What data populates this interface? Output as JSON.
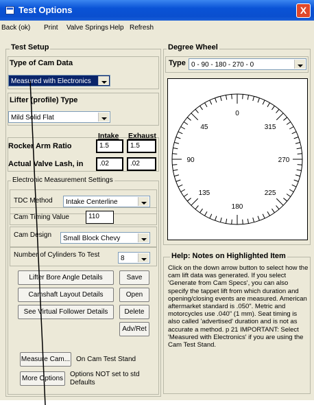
{
  "window": {
    "title": "Test Options",
    "close": "X"
  },
  "menu": [
    "Back (ok)",
    "Print",
    "Valve Springs",
    "Help",
    "Refresh"
  ],
  "test_setup": {
    "title": "Test Setup",
    "cam_data_label": "Type of Cam Data",
    "cam_data_value": "Measured with Electronics",
    "lifter_label": "Lifter (profile) Type",
    "lifter_value": "Mild Solid Flat",
    "intake_header": "Intake",
    "exhaust_header": "Exhaust",
    "rocker_label": "Rocker Arm Ratio",
    "rocker_intake": "1.5",
    "rocker_exhaust": "1.5",
    "lash_label": "Actual Valve Lash, in",
    "lash_intake": ".02",
    "lash_exhaust": ".02"
  },
  "electronic": {
    "title": "Electronic Measurement Settings",
    "tdc_label": "TDC Method",
    "tdc_value": "Intake Centerline",
    "timing_label": "Cam Timing Value",
    "timing_value": "110",
    "design_label": "Cam Design",
    "design_value": "Small Block Chevy",
    "cylinders_label": "Number of Cylinders To Test",
    "cylinders_value": "8",
    "btn_lifter": "Lifter Bore Angle Details",
    "btn_camshaft": "Camshaft Layout Details",
    "btn_follower": "See Virtual Follower Details",
    "btn_save": "Save",
    "btn_open": "Open",
    "btn_delete": "Delete",
    "btn_advret": "Adv/Ret",
    "btn_measure": "Measure Cam...",
    "measure_status": "On Cam Test Stand",
    "btn_more": "More Options",
    "more_status_1": "Options NOT set to std",
    "more_status_2": "Defaults"
  },
  "degree_wheel": {
    "title": "Degree Wheel",
    "type_label": "Type",
    "type_value": "0 - 90 - 180 - 270 - 0",
    "labels": [
      "0",
      "45",
      "315",
      "90",
      "270",
      "135",
      "225",
      "180"
    ]
  },
  "help": {
    "title": "Help:  Notes on Highlighted Item",
    "text": "Click on the down arrow button to select how the cam lift data was generated.  If you select 'Generate from Cam Specs', you can also specify the tappet lift from which duration and opening/closing events are measured.  American aftermarket standard is .050\". Metric and motorcycles use .040\" (1 mm).  Seat timing is also called 'advertised' duration and is not as accurate a method.  p 21       IMPORTANT:  Select 'Measured with Electronics' if you are using the Cam Test Stand."
  }
}
